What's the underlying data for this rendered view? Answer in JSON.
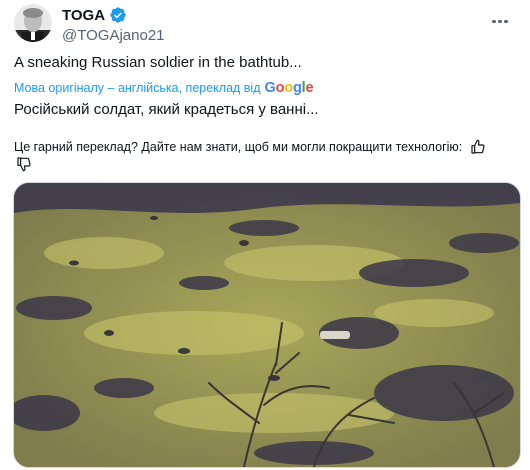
{
  "author": {
    "display_name": "TOGA",
    "handle": "@TOGAjano21",
    "avatar_icon": "avatar-photo-icon",
    "verified_icon": "verified-badge-icon"
  },
  "tweet": {
    "text": "A sneaking Russian soldier in the bathtub...",
    "translation_meta": "Мова оригіналу – англійська, переклад від",
    "translation_provider": "Google",
    "translated_text": "Російський солдат, який крадеться у ванні...",
    "feedback_question": "Це гарний переклад? Дайте нам знати, щоб ми могли покращити технологію:"
  },
  "colors": {
    "link_blue": "#1d9bf0",
    "secondary_text": "#536471",
    "verified_blue": "#1d9bf0"
  },
  "icons": {
    "more": "more-options-icon",
    "thumb_up": "thumbs-up-icon",
    "thumb_down": "thumbs-down-icon"
  },
  "media": {
    "type": "video-frame",
    "icon": "video-thumbnail-icon"
  }
}
